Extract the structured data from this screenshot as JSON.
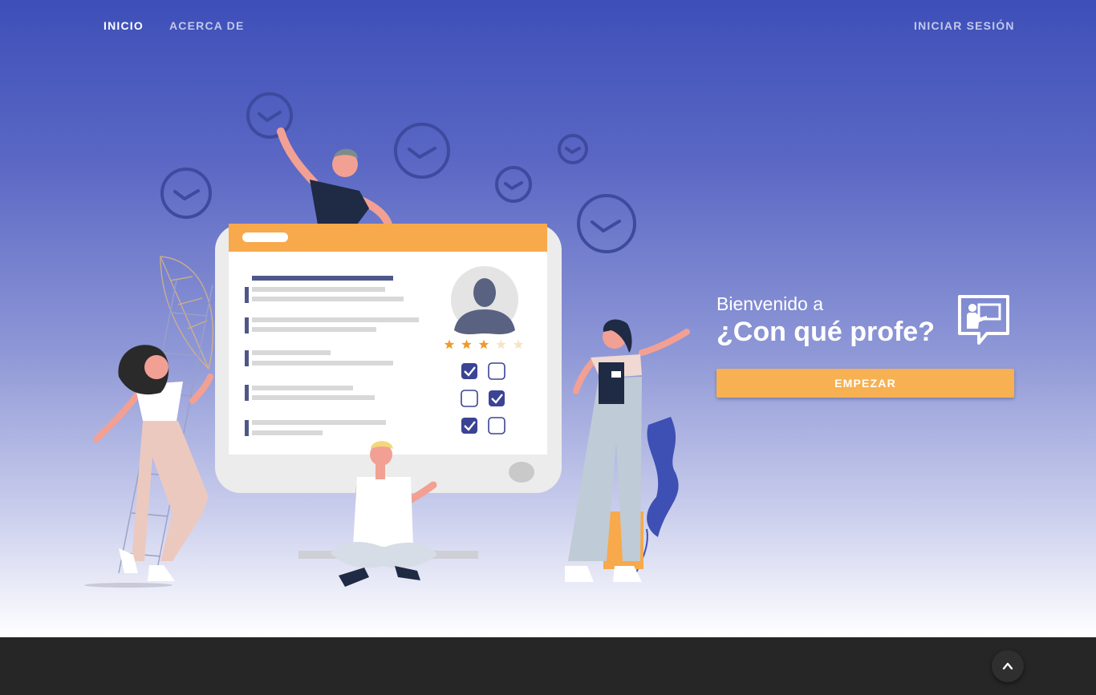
{
  "nav": {
    "home_label": "INICIO",
    "about_label": "ACERCA DE",
    "login_label": "INICIAR SESIÓN"
  },
  "welcome": {
    "subtitle": "Bienvenido a",
    "title": "¿Con qué profe?",
    "start_label": "EMPEZAR"
  },
  "rating": {
    "filled_stars": 3,
    "total_stars": 5
  },
  "icons": {
    "brand": "teacher-presentation-speech-bubble-icon",
    "scroll_top": "chevron-up-icon"
  },
  "colors": {
    "primary": "#3d4fb8",
    "accent": "#f7b152",
    "footer": "#262626"
  }
}
